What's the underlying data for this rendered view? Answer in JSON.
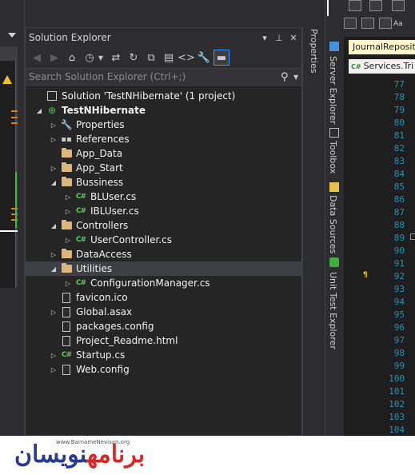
{
  "solution_explorer": {
    "title": "Solution Explorer",
    "search_placeholder": "Search Solution Explorer (Ctrl+;)",
    "tree": [
      {
        "label": "Solution 'TestNHibernate' (1 project)",
        "depth": 0,
        "toggle": "",
        "icon": "solution-icon",
        "bold": false
      },
      {
        "label": "TestNHibernate",
        "depth": 0,
        "toggle": "expanded",
        "icon": "web-project-icon",
        "bold": true
      },
      {
        "label": "Properties",
        "depth": 1,
        "toggle": "collapsed",
        "icon": "wrench-icon"
      },
      {
        "label": "References",
        "depth": 1,
        "toggle": "collapsed",
        "icon": "references-icon"
      },
      {
        "label": "App_Data",
        "depth": 1,
        "toggle": "",
        "icon": "folder-icon"
      },
      {
        "label": "App_Start",
        "depth": 1,
        "toggle": "collapsed",
        "icon": "folder-icon"
      },
      {
        "label": "Bussiness",
        "depth": 1,
        "toggle": "expanded",
        "icon": "folder-open-icon"
      },
      {
        "label": "BLUser.cs",
        "depth": 2,
        "toggle": "collapsed",
        "icon": "csharp-file-icon"
      },
      {
        "label": "IBLUser.cs",
        "depth": 2,
        "toggle": "collapsed",
        "icon": "csharp-file-icon"
      },
      {
        "label": "Controllers",
        "depth": 1,
        "toggle": "expanded",
        "icon": "folder-open-icon"
      },
      {
        "label": "UserController.cs",
        "depth": 2,
        "toggle": "collapsed",
        "icon": "csharp-file-icon"
      },
      {
        "label": "DataAccess",
        "depth": 1,
        "toggle": "collapsed",
        "icon": "folder-icon"
      },
      {
        "label": "Utilities",
        "depth": 1,
        "toggle": "expanded",
        "icon": "folder-open-icon",
        "selected": true
      },
      {
        "label": "ConfigurationManager.cs",
        "depth": 2,
        "toggle": "collapsed",
        "icon": "csharp-file-icon"
      },
      {
        "label": "favicon.ico",
        "depth": 1,
        "toggle": "",
        "icon": "file-icon"
      },
      {
        "label": "Global.asax",
        "depth": 1,
        "toggle": "collapsed",
        "icon": "file-icon"
      },
      {
        "label": "packages.config",
        "depth": 1,
        "toggle": "",
        "icon": "file-icon"
      },
      {
        "label": "Project_Readme.html",
        "depth": 1,
        "toggle": "",
        "icon": "file-icon"
      },
      {
        "label": "Startup.cs",
        "depth": 1,
        "toggle": "collapsed",
        "icon": "csharp-file-icon"
      },
      {
        "label": "Web.config",
        "depth": 1,
        "toggle": "collapsed",
        "icon": "file-icon"
      }
    ]
  },
  "side_tabs": {
    "properties": "Properties",
    "server_explorer": "Server Explorer",
    "toolbox": "Toolbox",
    "data_sources": "Data Sources",
    "unit_test_explorer": "Unit Test Explorer"
  },
  "editor": {
    "doc_tab": "JournalReposito",
    "nav_item": "Services.Tri",
    "line_numbers": [
      "77",
      "78",
      "79",
      "80",
      "81",
      "82",
      "83",
      "84",
      "85",
      "86",
      "87",
      "88",
      "89",
      "90",
      "91",
      "92",
      "93",
      "94",
      "95",
      "96",
      "97",
      "98",
      "99",
      "100",
      "101",
      "102",
      "103",
      "104"
    ]
  },
  "logo": {
    "text_red": "برنامه",
    "text_blue": "نویسان",
    "url": "www.BarnameNevisan.org"
  }
}
